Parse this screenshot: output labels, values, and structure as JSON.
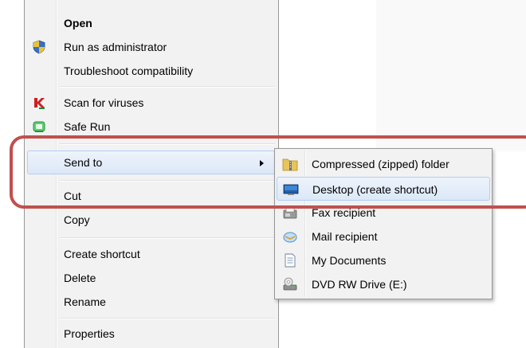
{
  "context_menu": {
    "items": [
      {
        "label": "Open",
        "icon": "none"
      },
      {
        "label": "Run as administrator",
        "icon": "uac-shield-icon"
      },
      {
        "label": "Troubleshoot compatibility",
        "icon": "none"
      },
      {
        "label": "Scan for viruses",
        "icon": "kaspersky-icon"
      },
      {
        "label": "Safe Run",
        "icon": "safe-run-icon"
      },
      {
        "label": "Send to",
        "icon": "none",
        "has_submenu": true
      },
      {
        "label": "Cut",
        "icon": "none"
      },
      {
        "label": "Copy",
        "icon": "none"
      },
      {
        "label": "Create shortcut",
        "icon": "none"
      },
      {
        "label": "Delete",
        "icon": "none"
      },
      {
        "label": "Rename",
        "icon": "none"
      },
      {
        "label": "Properties",
        "icon": "none"
      }
    ]
  },
  "send_to_menu": {
    "items": [
      {
        "label": "Compressed (zipped) folder",
        "icon": "zip-folder-icon"
      },
      {
        "label": "Desktop (create shortcut)",
        "icon": "desktop-icon"
      },
      {
        "label": "Fax recipient",
        "icon": "fax-icon"
      },
      {
        "label": "Mail recipient",
        "icon": "mail-icon"
      },
      {
        "label": "My Documents",
        "icon": "document-icon"
      },
      {
        "label": "DVD RW Drive (E:)",
        "icon": "dvd-drive-icon"
      }
    ]
  },
  "colors": {
    "highlight_border": "#aecff7",
    "annotation": "#c0504d",
    "menu_bg": "#f2f2f2"
  }
}
